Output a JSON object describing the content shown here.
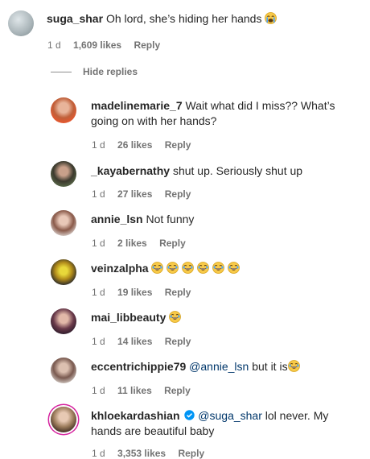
{
  "top_comment": {
    "username": "suga_shar",
    "text": "Oh lord, she’s hiding her hands",
    "emoji": "crying-emoji",
    "age": "1 d",
    "likes": "1,609 likes",
    "reply": "Reply"
  },
  "hide_replies_label": "Hide replies",
  "replies": [
    {
      "username": "madelinemarie_7",
      "text": "Wait what did I miss?? What’s going on with her hands?",
      "age": "1 d",
      "likes": "26 likes",
      "reply": "Reply"
    },
    {
      "username": "_kayabernathy",
      "text": "shut up. Seriously shut up",
      "age": "1 d",
      "likes": "27 likes",
      "reply": "Reply"
    },
    {
      "username": "annie_lsn",
      "text": "Not funny",
      "age": "1 d",
      "likes": "2 likes",
      "reply": "Reply"
    },
    {
      "username": "veinzalpha",
      "text": "",
      "emoji": "laughing-emoji x6",
      "age": "1 d",
      "likes": "19 likes",
      "reply": "Reply"
    },
    {
      "username": "mai_libbeauty",
      "text": "",
      "emoji": "laughing-emoji",
      "age": "1 d",
      "likes": "14 likes",
      "reply": "Reply"
    },
    {
      "username": "eccentrichippie79",
      "mention": "@annie_lsn",
      "text": " but it is",
      "emoji": "laughing-emoji",
      "age": "1 d",
      "likes": "11 likes",
      "reply": "Reply"
    },
    {
      "username": "khloekardashian",
      "verified": true,
      "mention": "@suga_shar",
      "text": " lol never. My hands are beautiful baby",
      "age": "1 d",
      "likes": "3,353 likes",
      "reply": "Reply"
    }
  ],
  "colors": {
    "text": "#262626",
    "meta": "#737373",
    "mention": "#00376b",
    "verified": "#0095f6",
    "story_ring": "#d6249f"
  }
}
